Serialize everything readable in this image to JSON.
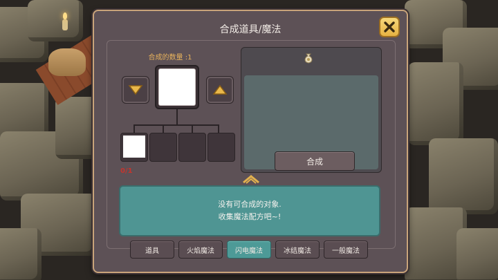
{
  "dialog": {
    "title": "合成道具/魔法",
    "close_icon": "close-x-icon"
  },
  "recipe": {
    "quantity_label": "合成的数量 :1",
    "material_count": "0/1",
    "decrease_icon": "triangle-down-icon",
    "increase_icon": "triangle-up-icon"
  },
  "result": {
    "bag_icon": "money-bag-icon",
    "compose_label": "合成"
  },
  "message": {
    "line1": "没有可合成的对象.",
    "line2": "收集魔法配方吧~!"
  },
  "tabs": [
    {
      "label": "道具",
      "active": false
    },
    {
      "label": "火焰魔法",
      "active": false
    },
    {
      "label": "闪电魔法",
      "active": true
    },
    {
      "label": "冰结魔法",
      "active": false
    },
    {
      "label": "一般魔法",
      "active": false
    }
  ],
  "colors": {
    "accent_gold": "#e6b242",
    "active_tab": "#4d9a97",
    "count_red": "#c4352e",
    "label_orange": "#e7b25c"
  }
}
